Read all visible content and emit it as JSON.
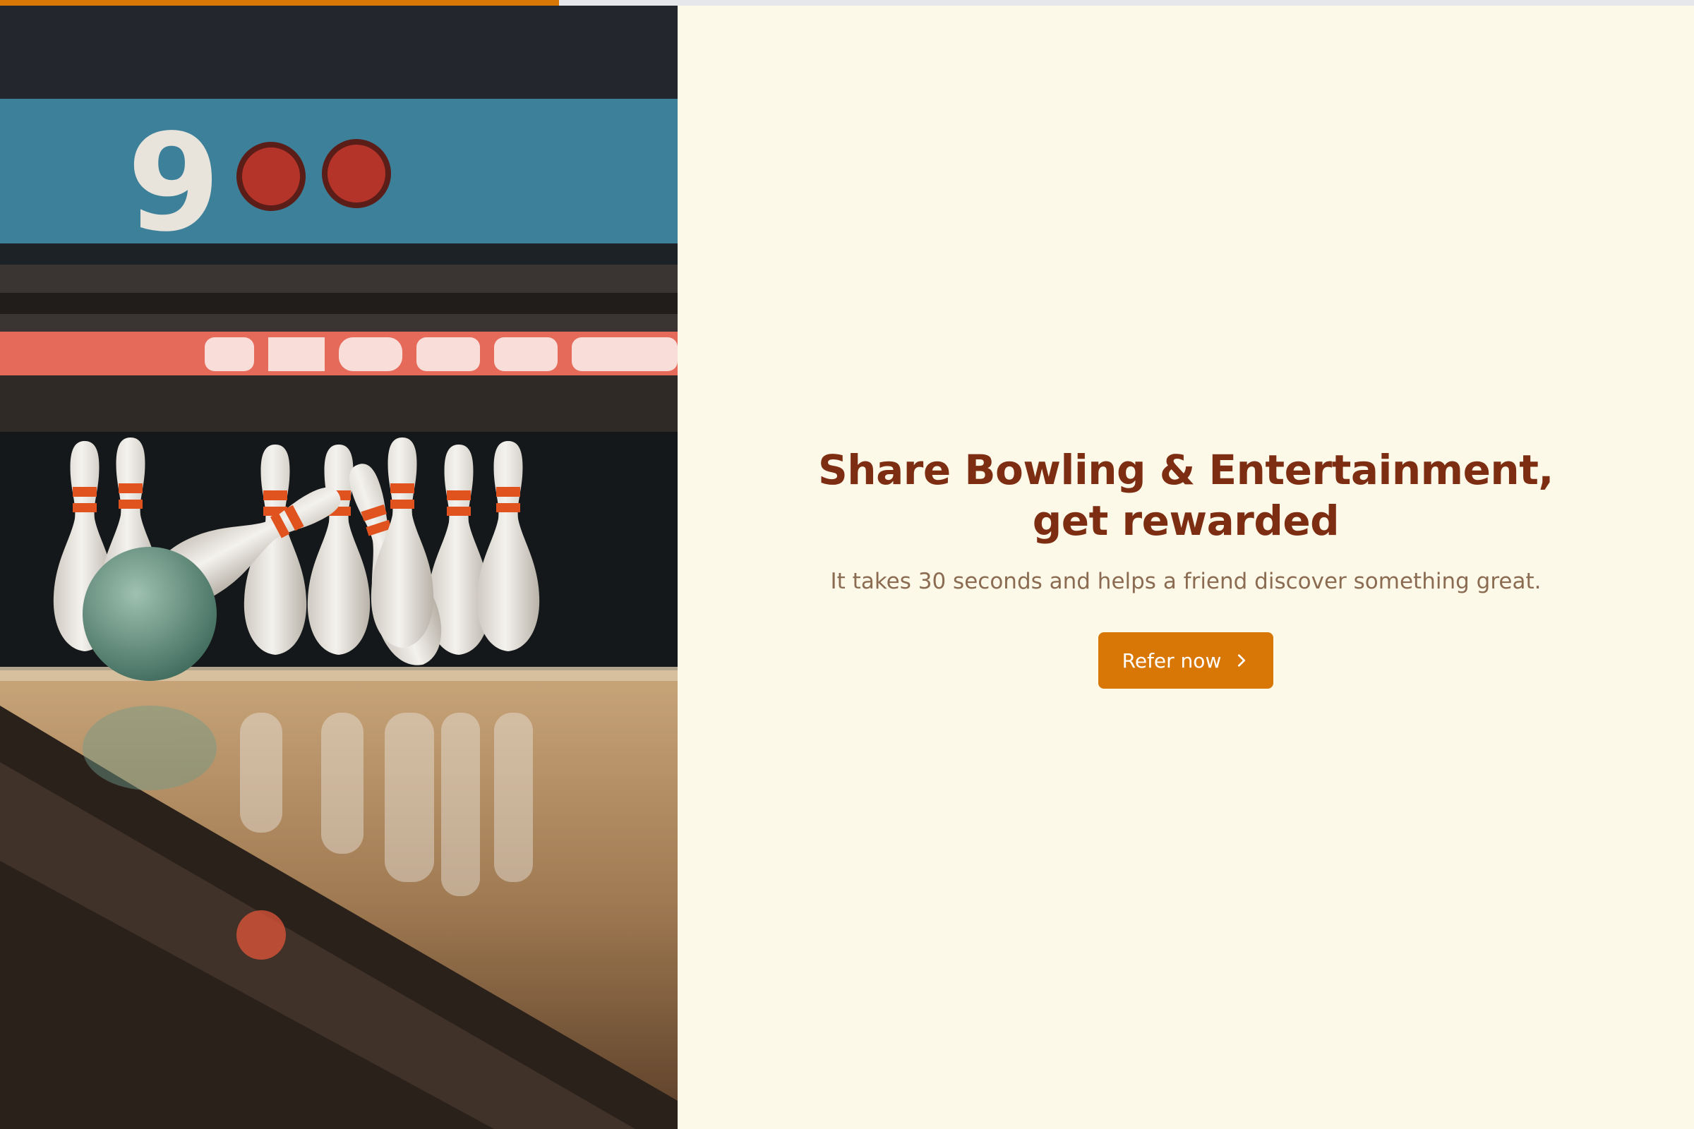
{
  "progress": {
    "percent": 33,
    "fill_color": "#d97706",
    "track_color": "#e5e7eb"
  },
  "hero": {
    "image": "bowling-pins-photo",
    "scoreboard_number": "9"
  },
  "main": {
    "headline": "Share Bowling & Entertainment, get rewarded",
    "subtext": "It takes 30 seconds and helps a friend discover something great.",
    "cta_label": "Refer now",
    "cta_icon": "chevron-right-icon"
  },
  "colors": {
    "background": "#fdf9e8",
    "headline": "#7c2d12",
    "subtext": "#8b6c52",
    "accent": "#d97706"
  }
}
